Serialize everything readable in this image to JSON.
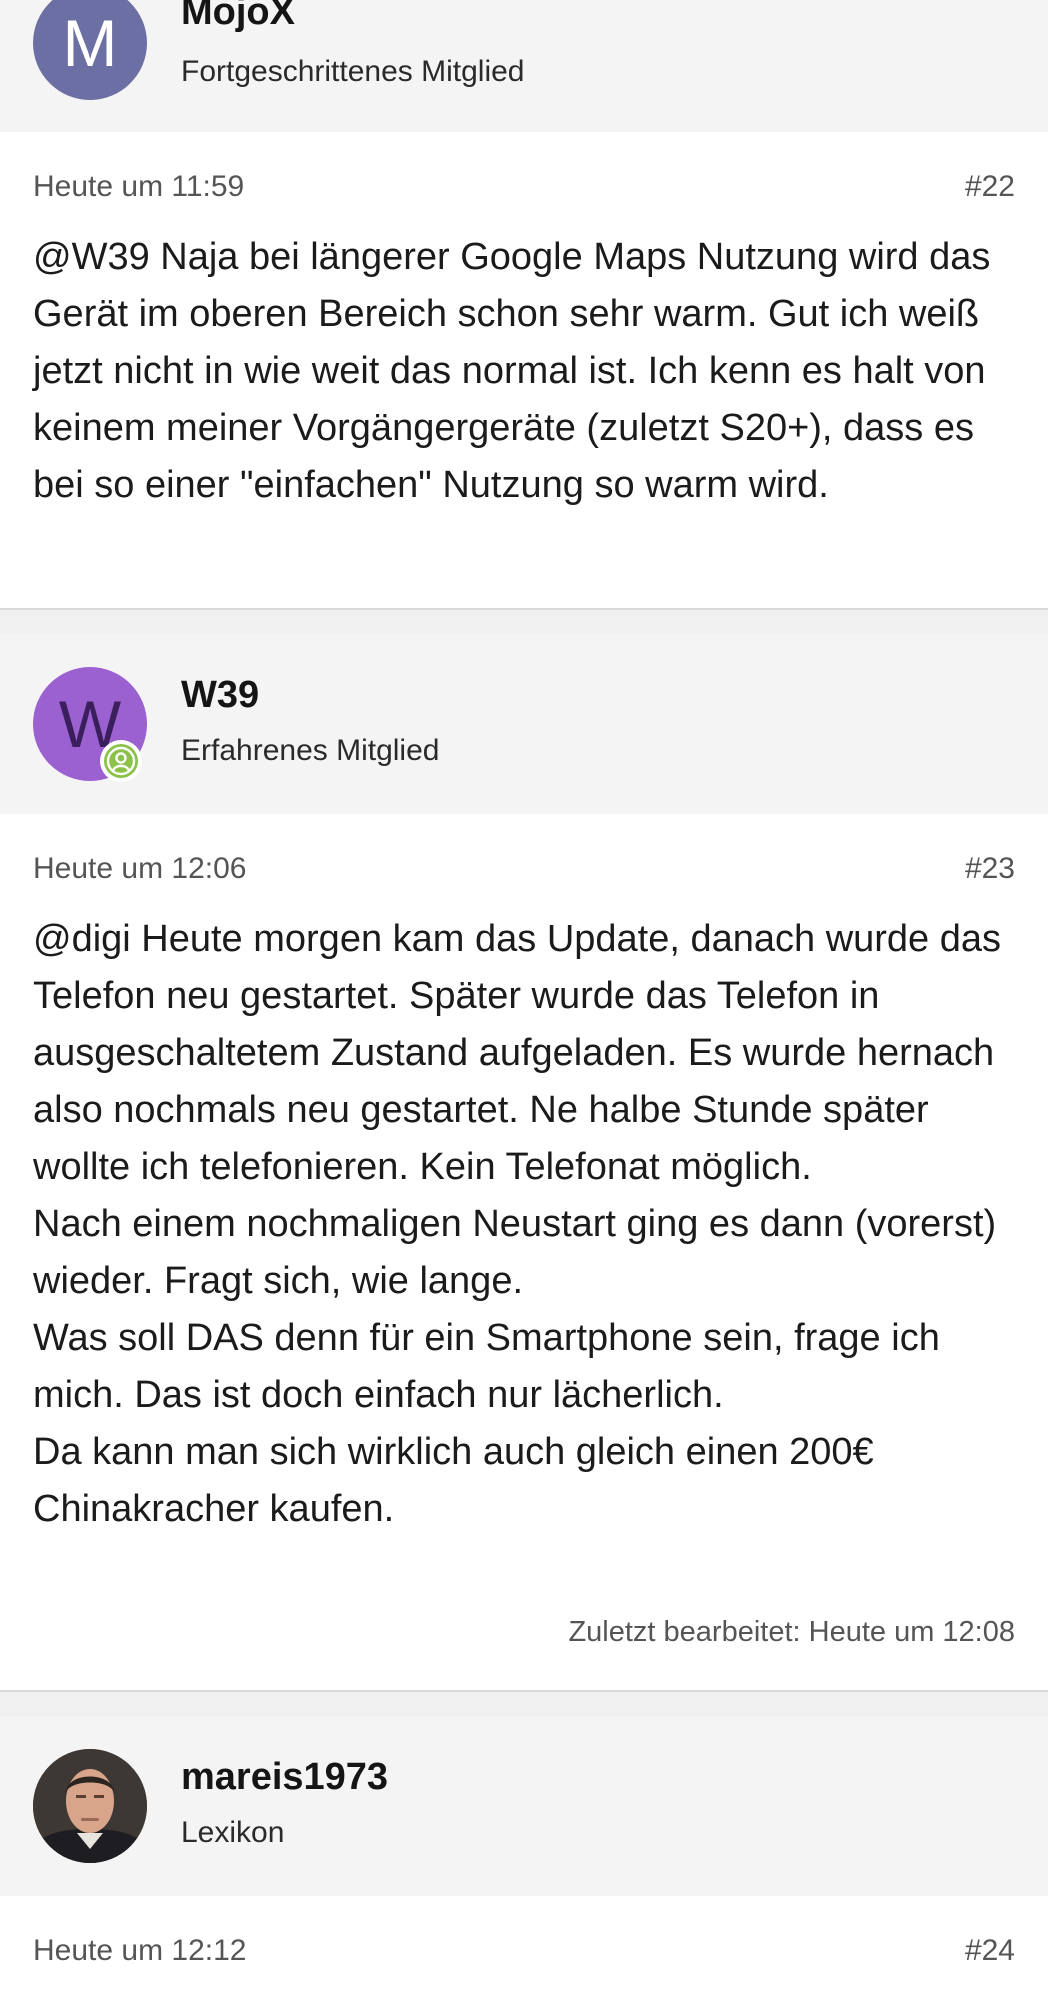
{
  "posts": [
    {
      "author": "MojoX",
      "role": "Fortgeschrittenes Mitglied",
      "avatar_letter": "M",
      "avatar_color": "#6b6fa3",
      "time": "Heute um 11:59",
      "number": "#22",
      "body": [
        "@W39 Naja bei längerer Google Maps Nutzung wird das Gerät im oberen Bereich schon sehr warm. Gut ich weiß jetzt nicht in wie weit das normal ist. Ich kenn es halt von keinem meiner Vorgängergeräte (zuletzt S20+), dass es bei so einer \"einfachen\" Nutzung so warm wird."
      ]
    },
    {
      "author": "W39",
      "role": "Erfahrenes Mitglied",
      "avatar_letter": "W",
      "avatar_color": "#9b61d1",
      "time": "Heute um 12:06",
      "number": "#23",
      "body": [
        "@digi Heute morgen kam das Update, danach wurde das Telefon neu gestartet. Später wurde das Telefon in ausgeschaltetem Zustand aufgeladen. Es wurde hernach also nochmals neu gestartet. Ne halbe Stunde später wollte ich telefonieren. Kein Telefonat möglich.",
        "Nach einem nochmaligen Neustart ging es dann (vorerst) wieder. Fragt sich, wie lange.",
        "Was soll DAS denn für ein Smartphone sein, frage ich mich. Das ist doch einfach nur lächerlich.",
        "Da kann man sich wirklich auch gleich einen 200€ Chinakracher kaufen."
      ],
      "edited": "Zuletzt bearbeitet: Heute um 12:08"
    },
    {
      "author": "mareis1973",
      "role": "Lexikon",
      "time": "Heute um 12:12",
      "number": "#24"
    }
  ],
  "colors": {
    "header_bg": "#f4f4f4",
    "online_badge": "#8bc34a"
  },
  "icons": {
    "online_status": "user-circle-icon"
  }
}
